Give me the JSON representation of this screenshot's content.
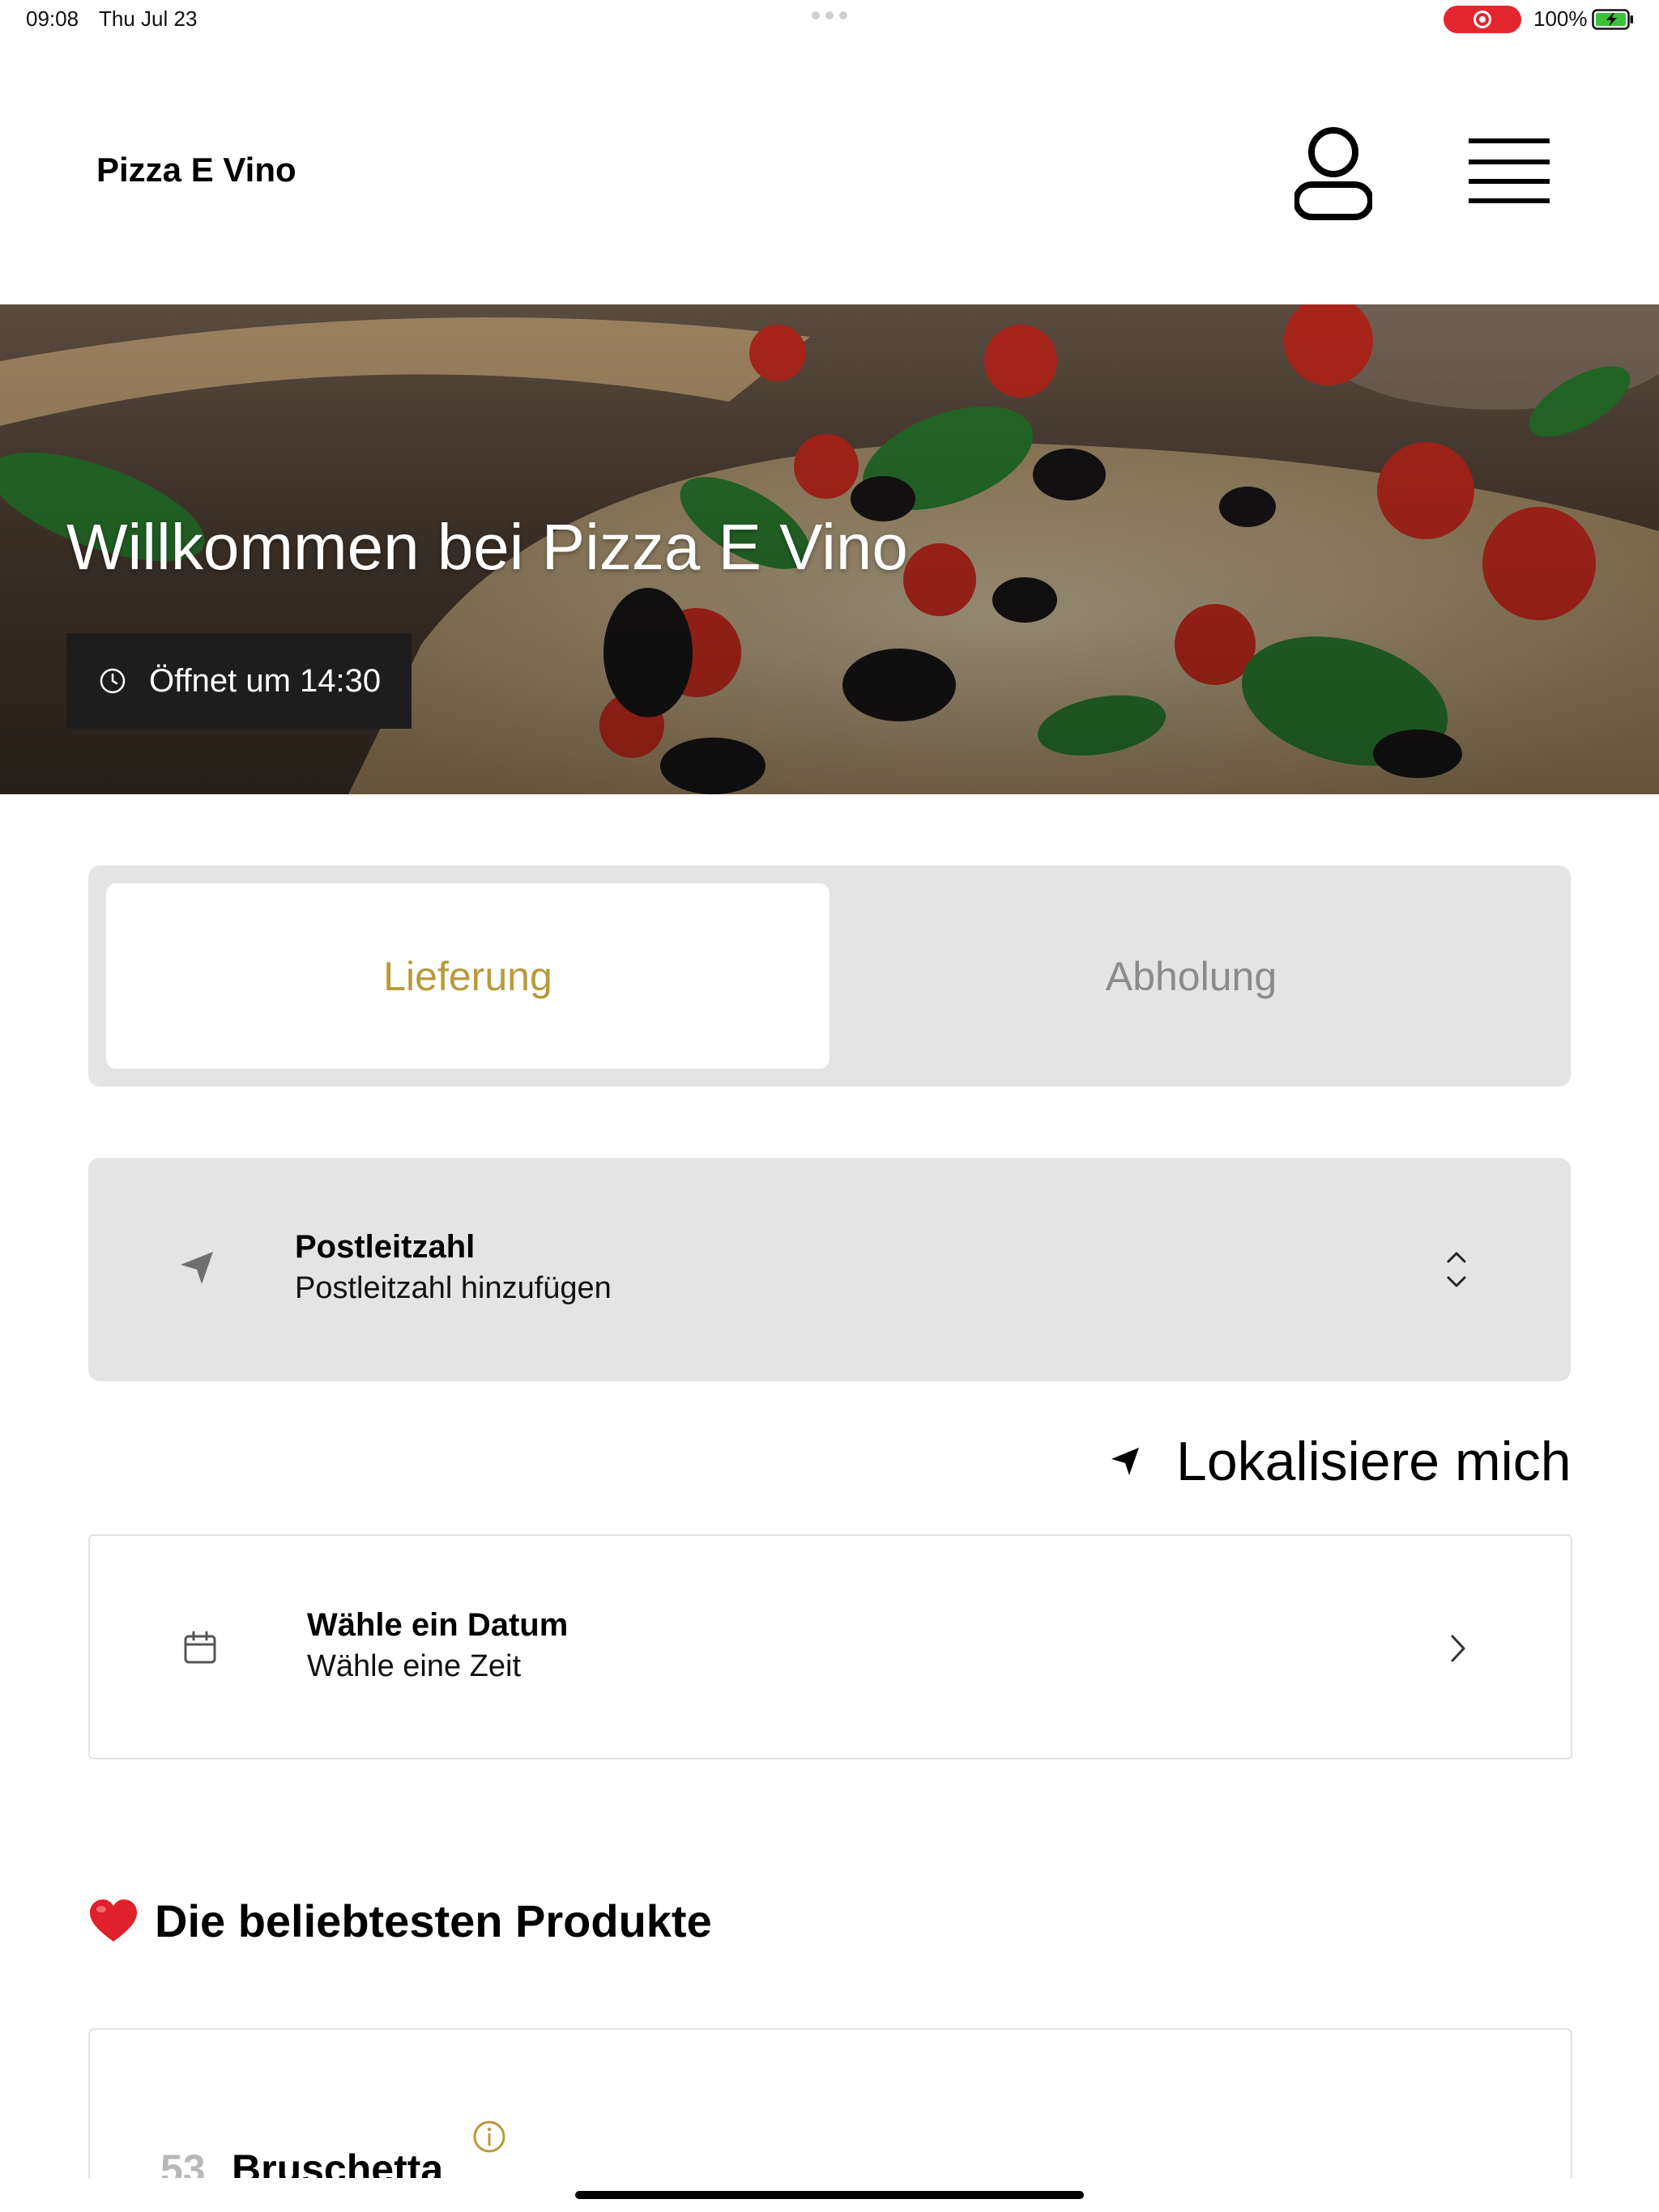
{
  "status_bar": {
    "time": "09:08",
    "date": "Thu Jul 23",
    "battery": "100%"
  },
  "header": {
    "brand": "Pizza E Vino"
  },
  "hero": {
    "title": "Willkommen bei Pizza E Vino",
    "open_badge": "Öffnet um 14:30"
  },
  "order_mode": {
    "tabs": [
      {
        "label": "Lieferung",
        "active": true
      },
      {
        "label": "Abholung",
        "active": false
      }
    ]
  },
  "postcode": {
    "title": "Postleitzahl",
    "placeholder": "Postleitzahl hinzufügen"
  },
  "locate_label": "Lokalisiere mich",
  "schedule": {
    "title": "Wähle ein Datum",
    "subtitle": "Wähle eine Zeit"
  },
  "popular": {
    "heading": "Die beliebtesten Produkte",
    "items": [
      {
        "number": "53",
        "name": "Bruschetta"
      }
    ]
  },
  "colors": {
    "accent": "#b99a3a",
    "panel": "#e4e4e4",
    "badge_bg": "#1d1d1d",
    "record": "#e3262e"
  },
  "icons": {
    "profile": "user-icon",
    "menu": "hamburger-menu-icon",
    "clock": "clock-icon",
    "location": "navigation-arrow-icon",
    "updown": "chevron-up-down-icon",
    "calendar": "calendar-icon",
    "chevron": "chevron-right-icon",
    "heart": "heart-icon",
    "info": "info-icon"
  }
}
